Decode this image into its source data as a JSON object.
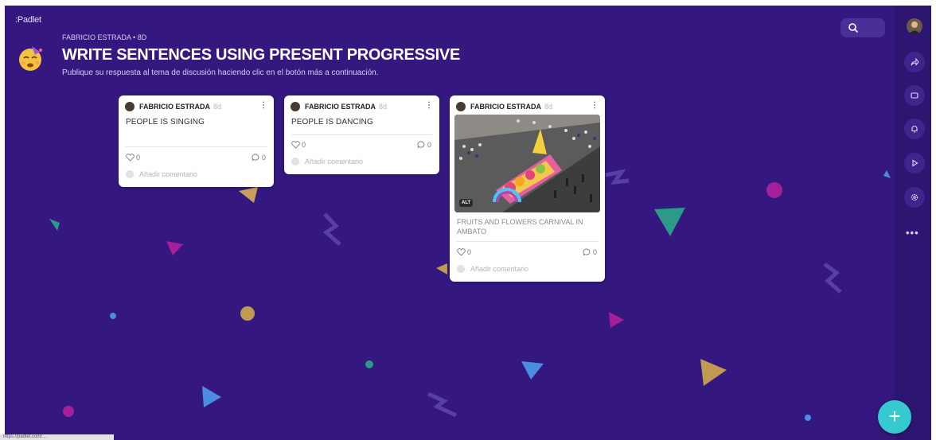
{
  "app": {
    "brand": ":Padlet"
  },
  "board": {
    "author": "FABRICIO ESTRADA",
    "age": "8d",
    "title": "WRITE SENTENCES USING PRESENT PROGRESSIVE",
    "description": "Publique su respuesta al tema de discusión haciendo clic en el botón más a continuación."
  },
  "posts": [
    {
      "author": "FABRICIO ESTRADA",
      "age": "8d",
      "text": "PEOPLE IS SINGING",
      "likes": "0",
      "comments": "0",
      "add_comment": "Añadir comentario"
    },
    {
      "author": "FABRICIO ESTRADA",
      "age": "8d",
      "text": "PEOPLE IS DANCING",
      "likes": "0",
      "comments": "0",
      "add_comment": "Añadir comentario"
    },
    {
      "author": "FABRICIO ESTRADA",
      "age": "8d",
      "text": "FRUITS AND FLOWERS CARNIVAL IN AMBATO",
      "likes": "0",
      "comments": "0",
      "add_comment": "Añadir comentario",
      "image_badge": "ALT"
    }
  ],
  "toolbar": {
    "more": "•••",
    "fab": "+"
  },
  "statusbar": {
    "text": "https://padlet.com/..."
  },
  "colors": {
    "background": "#35187f",
    "rail": "#2d1672",
    "fab": "#35c9d0"
  }
}
